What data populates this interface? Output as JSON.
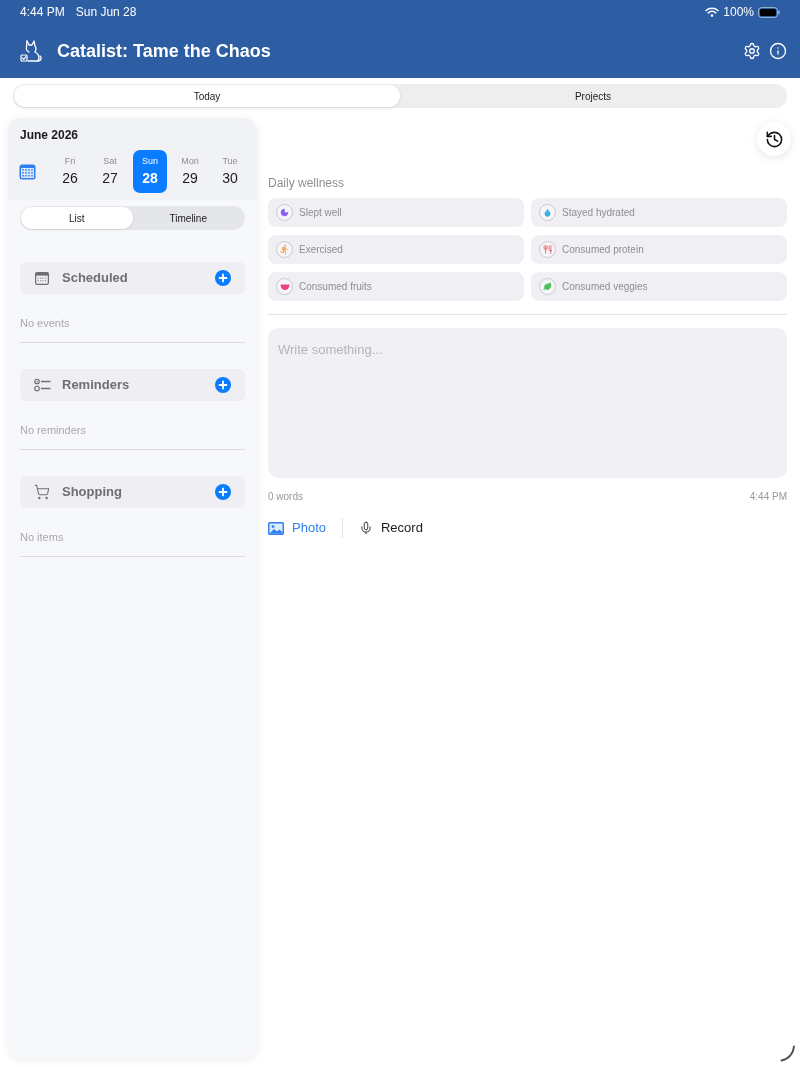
{
  "status_bar": {
    "time": "4:44 PM",
    "date": "Sun Jun 28",
    "battery": "100%"
  },
  "header": {
    "title": "Catalist: Tame the Chaos"
  },
  "tabs": [
    {
      "label": "Today",
      "selected": true
    },
    {
      "label": "Projects",
      "selected": false
    }
  ],
  "sidebar": {
    "month": "June 2026",
    "days": [
      {
        "weekday": "Fri",
        "date": "26",
        "selected": false
      },
      {
        "weekday": "Sat",
        "date": "27",
        "selected": false
      },
      {
        "weekday": "Sun",
        "date": "28",
        "selected": true
      },
      {
        "weekday": "Mon",
        "date": "29",
        "selected": false
      },
      {
        "weekday": "Tue",
        "date": "30",
        "selected": false
      }
    ],
    "view_toggle": [
      {
        "label": "List",
        "selected": true
      },
      {
        "label": "Timeline",
        "selected": false
      }
    ],
    "sections": [
      {
        "kind": "scheduled",
        "title": "Scheduled",
        "empty_text": "No events"
      },
      {
        "kind": "reminders",
        "title": "Reminders",
        "empty_text": "No reminders"
      },
      {
        "kind": "shopping",
        "title": "Shopping",
        "empty_text": "No items"
      }
    ]
  },
  "wellness": {
    "title": "Daily wellness",
    "items": [
      {
        "kind": "sleep",
        "label": "Slept well"
      },
      {
        "kind": "water",
        "label": "Stayed hydrated"
      },
      {
        "kind": "exercise",
        "label": "Exercised"
      },
      {
        "kind": "protein",
        "label": "Consumed protein"
      },
      {
        "kind": "fruits",
        "label": "Consumed fruits"
      },
      {
        "kind": "veggies",
        "label": "Consumed veggies"
      }
    ]
  },
  "editor": {
    "placeholder": "Write something...",
    "word_count": "0 words",
    "time": "4:44 PM"
  },
  "attachments": [
    {
      "kind": "photo",
      "label": "Photo"
    },
    {
      "kind": "record",
      "label": "Record"
    }
  ]
}
